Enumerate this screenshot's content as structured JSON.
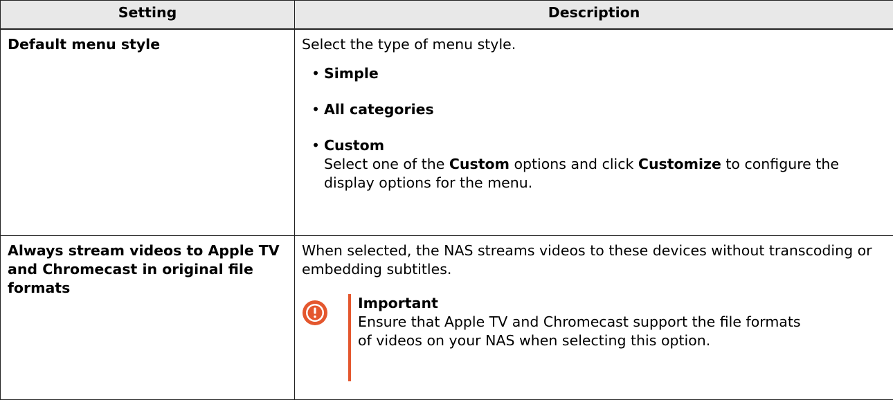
{
  "table": {
    "headers": [
      "Setting",
      "Description"
    ],
    "row1": {
      "setting": "Default menu style",
      "intro": "Select the type of menu style.",
      "bullet": "•",
      "options": [
        "Simple",
        "All categories",
        "Custom"
      ],
      "custom_detail": {
        "p1": "Select one of the ",
        "b1": "Custom",
        "p2": " options and click ",
        "b2": "Customize",
        "p3": " to configure the display options for the menu."
      }
    },
    "row2": {
      "setting": "Always stream videos to Apple TV and Chromecast in original file formats",
      "description": "When selected, the NAS streams videos to these devices without transcoding or embedding subtitles.",
      "notice": {
        "title": "Important",
        "text": "Ensure that Apple TV and Chromecast support the file formats of videos on your NAS when selecting this option.",
        "icon": "important-exclamation-icon",
        "accent_color": "#e4572e"
      }
    }
  }
}
